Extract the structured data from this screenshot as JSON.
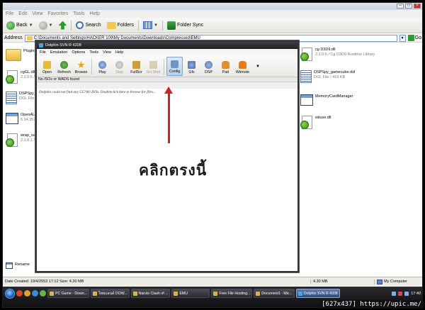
{
  "explorer": {
    "menu": [
      "File",
      "Edit",
      "View",
      "Favorites",
      "Tools",
      "Help"
    ],
    "toolbar": {
      "back": "Back",
      "search": "Search",
      "folders": "Folders",
      "folder_sync": "Folder Sync"
    },
    "address": {
      "label": "Address",
      "path": "C:\\Documents and Settings\\HACKER 109\\My Documents\\Downloads\\Compressed\\EMU",
      "go": "Go"
    },
    "files_left": [
      {
        "name": "Plugins",
        "sub": "",
        "type": "folder"
      },
      {
        "name": "cgGL.dll",
        "sub": "2.2.0.6 / Cg OpenGL",
        "type": "dll"
      },
      {
        "name": "DSPSpy_",
        "sub": "DOL File / 527 KB",
        "type": "doc"
      },
      {
        "name": "OpenAL32",
        "sub": "6.14.357 / Standard",
        "type": "exe"
      },
      {
        "name": "wrap_oal",
        "sub": "2.1.8.1 / OpenAL",
        "type": "dll"
      }
    ],
    "files_right": [
      {
        "name": "cg D3D9.dll",
        "sub": "2.2.0.6 / Cg D3D9 Runtime Library",
        "type": "dll"
      },
      {
        "name": "DSPSpy_gamecube.dol",
        "sub": "DOL File / 416 KB",
        "type": "doc"
      },
      {
        "name": "MemoryCardManager",
        "sub": "",
        "type": "exe"
      },
      {
        "name": "wiiuse.dll",
        "sub": "",
        "type": "dll"
      }
    ],
    "rename_label": "Rename",
    "status": {
      "left": "Date Created: 19/4/2553 17:12 Size: 4.30 MB",
      "size": "4.30 MB",
      "location": "My Computer"
    }
  },
  "dolphin": {
    "title": "Dolphin SVN R 4208",
    "menu": [
      "File",
      "Emulation",
      "Options",
      "Tools",
      "View",
      "Help"
    ],
    "toolbar": [
      "Open",
      "Refresh",
      "Browse",
      "Play",
      "Stop",
      "FullScr",
      "Scr.Shot",
      "Config",
      "Gfx",
      "DSP",
      "Pad",
      "Wiimote"
    ],
    "list_header": "No ISOs or WADS found",
    "empty_message": "Dolphin could not find any GC/Wii ISOs. Doubleclick here to browse for files..."
  },
  "annotation": {
    "text": "คลิกตรงนี้",
    "color": "#d21f2b"
  },
  "taskbar": {
    "tasks": [
      "PC Game - Down...",
      "ไทยแลนด์ DOW...",
      "Naruto Clash of ...",
      "EMU",
      "Free File Hosting...",
      "Document1 - Mic...",
      "Dolphin SVN R 4208"
    ],
    "active_index": 6,
    "clock": "17:40"
  },
  "watermark": "[627x437] https://upic.me/"
}
